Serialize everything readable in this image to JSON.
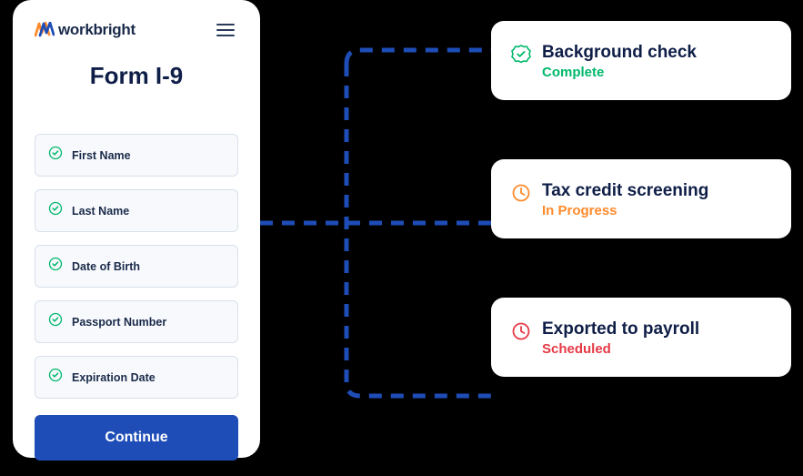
{
  "brand": {
    "name": "workbright"
  },
  "form": {
    "title": "Form I-9",
    "fields": [
      {
        "label": "First Name"
      },
      {
        "label": "Last Name"
      },
      {
        "label": "Date of Birth"
      },
      {
        "label": "Passport Number"
      },
      {
        "label": "Expiration Date"
      }
    ],
    "button": "Continue"
  },
  "statuses": [
    {
      "title": "Background check",
      "sub": "Complete",
      "state": "green"
    },
    {
      "title": "Tax credit screening",
      "sub": "In Progress",
      "state": "orange"
    },
    {
      "title": "Exported to payroll",
      "sub": "Scheduled",
      "state": "red"
    }
  ],
  "colors": {
    "primary": "#1e4db7",
    "navy": "#0f1e47",
    "green": "#00b86b",
    "orange": "#ff8a2b",
    "red": "#e63946"
  }
}
